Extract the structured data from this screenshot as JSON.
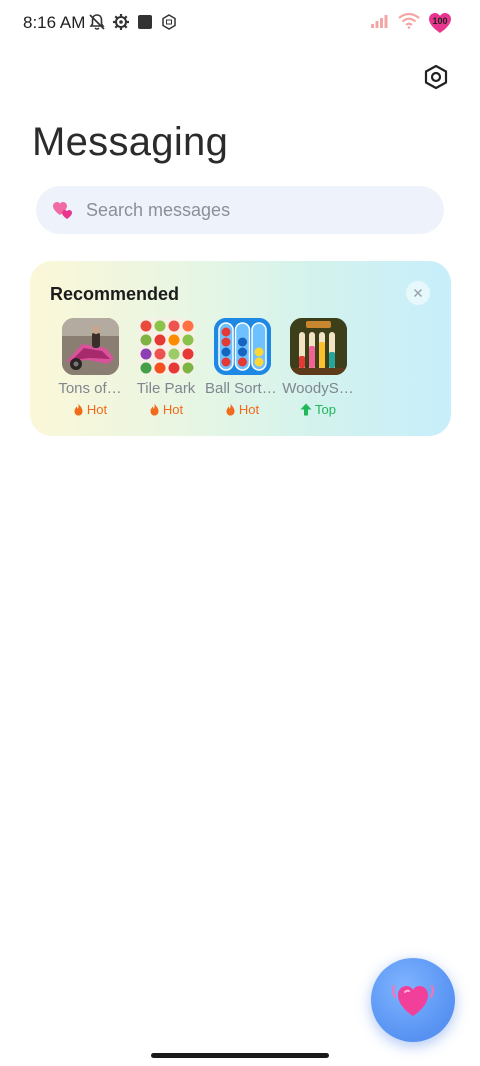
{
  "status_bar": {
    "time": "8:16 AM",
    "battery": "100",
    "icons": [
      "notifications-off-icon",
      "gear-icon",
      "square-icon",
      "sim-icon",
      "signal-icon",
      "wifi-icon",
      "battery-heart-icon"
    ]
  },
  "header": {
    "title": "Messaging",
    "settings_icon": "settings-hexagon-icon"
  },
  "search": {
    "placeholder": "Search messages",
    "value": "",
    "icon": "two-hearts-icon"
  },
  "recommended": {
    "title": "Recommended",
    "close_icon": "close-icon",
    "apps": [
      {
        "name": "Tons of…",
        "badge": "Hot",
        "badge_type": "hot",
        "icon": "tons-of-game-icon"
      },
      {
        "name": "Tile Park",
        "badge": "Hot",
        "badge_type": "hot",
        "icon": "tile-park-icon"
      },
      {
        "name": "Ball Sort:…",
        "badge": "Hot",
        "badge_type": "hot",
        "icon": "ball-sort-icon"
      },
      {
        "name": "WoodyS…",
        "badge": "Top",
        "badge_type": "top",
        "icon": "woody-sort-icon"
      }
    ]
  },
  "fab": {
    "icon": "heart-icon"
  },
  "colors": {
    "accent_blue": "#5c97f4",
    "hot": "#f26a1b",
    "top": "#1fb85a",
    "heart_pink": "#e8368f"
  }
}
